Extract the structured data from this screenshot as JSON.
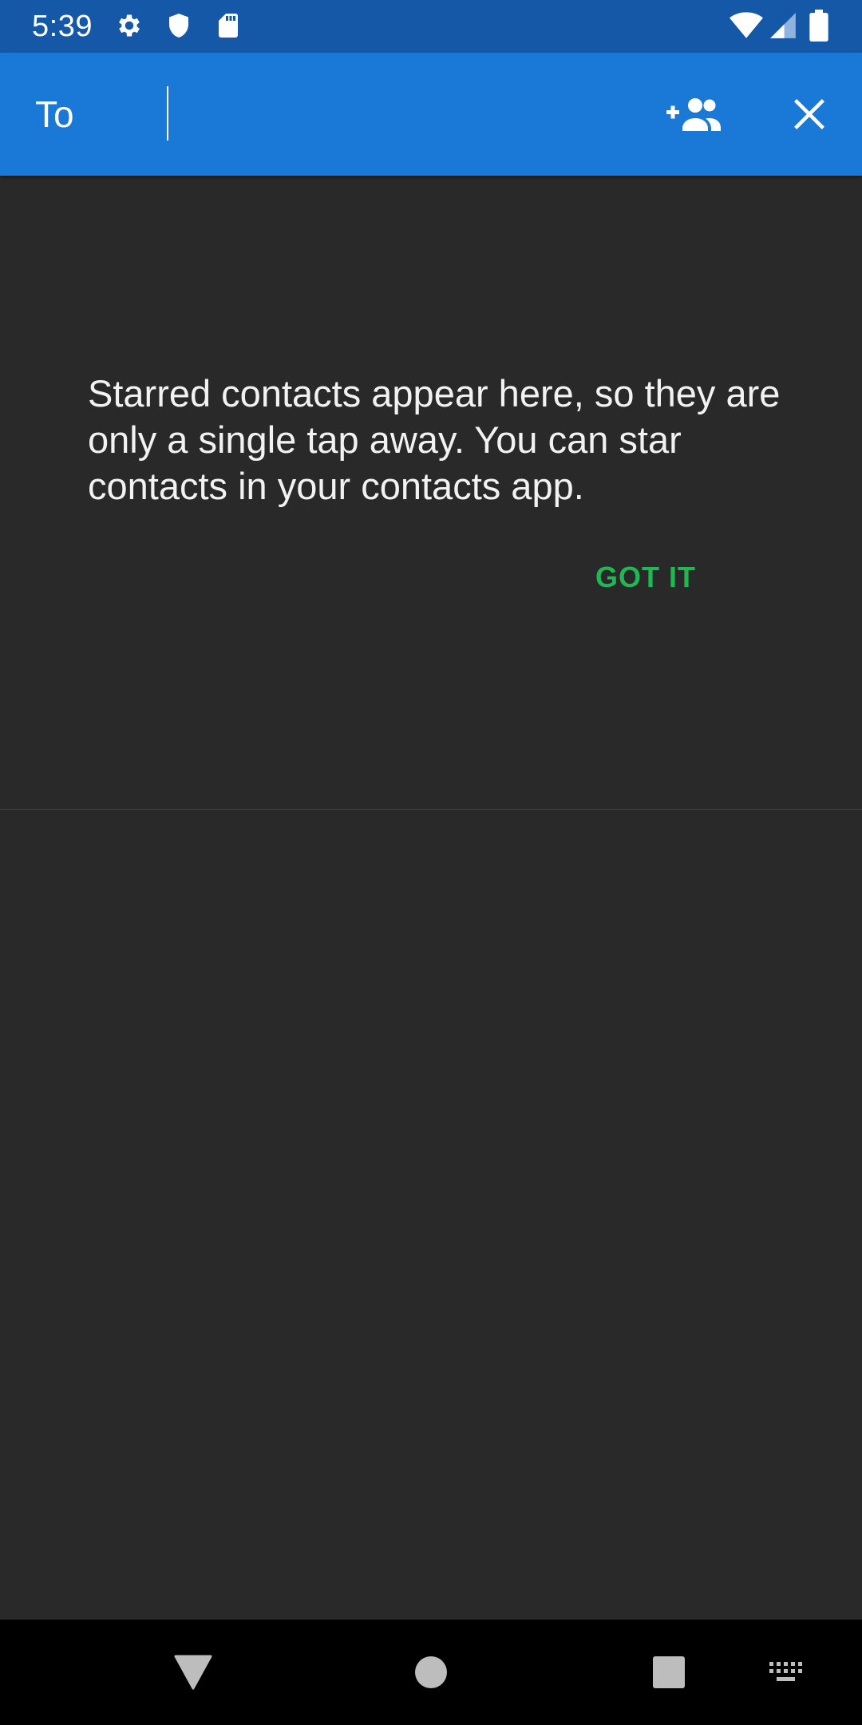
{
  "status_bar": {
    "time": "5:39",
    "left_icons": [
      "settings-icon",
      "shield-icon",
      "sd-card-icon"
    ],
    "right_icons": [
      "wifi-icon",
      "signal-icon",
      "battery-icon"
    ]
  },
  "app_bar": {
    "to_label": "To",
    "recipient_value": "",
    "actions": [
      "add-group-icon",
      "close-icon"
    ]
  },
  "starred_hint": {
    "message": "Starred contacts appear here, so they are only a single tap away. You can star contacts in your contacts app.",
    "button_label": "GOT IT"
  },
  "nav_bar": {
    "buttons": [
      "back-icon",
      "home-icon",
      "recents-icon",
      "keyboard-icon"
    ]
  },
  "colors": {
    "status_bar": "#1558a8",
    "app_bar": "#1a78d6",
    "background": "#292929",
    "accent": "#1fb954"
  }
}
